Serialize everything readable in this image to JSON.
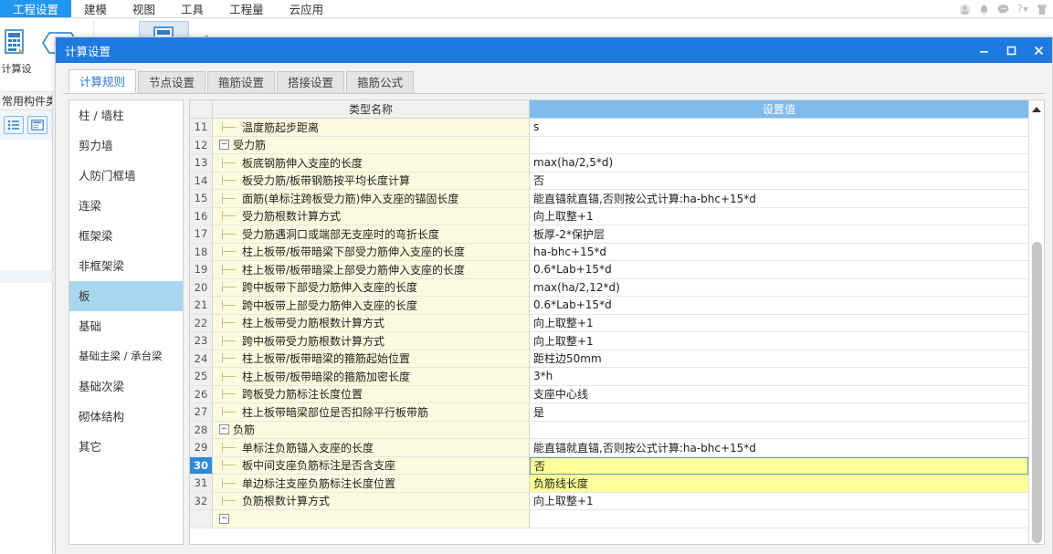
{
  "app": {
    "menu": [
      {
        "label": "工程设置",
        "active": true
      },
      {
        "label": "建模",
        "active": false
      },
      {
        "label": "视图",
        "active": false
      },
      {
        "label": "工具",
        "active": false
      },
      {
        "label": "工程量",
        "active": false
      },
      {
        "label": "云应用",
        "active": false
      }
    ],
    "sys_icons": [
      "account-icon",
      "bell-icon",
      "chat-icon",
      "help-icon",
      "shirt-icon"
    ],
    "ribbon": [
      {
        "icon": "calc-settings-icon",
        "label": "计算设",
        "selected": false
      },
      {
        "icon": "plus-minus-icon",
        "label": "",
        "selected": false
      },
      {
        "icon": "calc-rule-icon",
        "label": "",
        "selected": true
      },
      {
        "icon": "rebar-edit-1-icon",
        "label": "",
        "selected": false
      },
      {
        "icon": "rebar-edit-2-icon",
        "label": "",
        "selected": false
      },
      {
        "icon": "rebar-edit-3-icon",
        "label": "",
        "selected": false
      }
    ],
    "left_panel": {
      "title": "常用构件类",
      "icons": [
        "list-view-icon",
        "card-view-icon"
      ]
    }
  },
  "dialog": {
    "title": "计算设置",
    "window_buttons": {
      "minimize": "minimize-button",
      "maximize": "maximize-button",
      "close": "close-button"
    },
    "tabs": [
      {
        "label": "计算规则",
        "active": true
      },
      {
        "label": "节点设置",
        "active": false
      },
      {
        "label": "箍筋设置",
        "active": false
      },
      {
        "label": "搭接设置",
        "active": false
      },
      {
        "label": "箍筋公式",
        "active": false
      }
    ],
    "sidebar": [
      {
        "label": "柱 / 墙柱",
        "active": false
      },
      {
        "label": "剪力墙",
        "active": false
      },
      {
        "label": "人防门框墙",
        "active": false
      },
      {
        "label": "连梁",
        "active": false
      },
      {
        "label": "框架梁",
        "active": false
      },
      {
        "label": "非框架梁",
        "active": false
      },
      {
        "label": "板",
        "active": true
      },
      {
        "label": "基础",
        "active": false
      },
      {
        "label": "基础主梁 / 承台梁",
        "active": false
      },
      {
        "label": "基础次梁",
        "active": false
      },
      {
        "label": "砌体结构",
        "active": false
      },
      {
        "label": "其它",
        "active": false
      }
    ],
    "grid": {
      "headers": {
        "num": "",
        "name": "类型名称",
        "value": "设置值"
      },
      "rows": [
        {
          "num": "11",
          "kind": "leaf",
          "name": "温度筋起步距离",
          "value": "s",
          "selected": false,
          "value_state": "normal"
        },
        {
          "num": "12",
          "kind": "group",
          "name": "受力筋",
          "value": "",
          "selected": false,
          "value_state": "normal"
        },
        {
          "num": "13",
          "kind": "leaf",
          "name": "板底钢筋伸入支座的长度",
          "value": "max(ha/2,5*d)",
          "selected": false,
          "value_state": "normal"
        },
        {
          "num": "14",
          "kind": "leaf",
          "name": "板受力筋/板带钢筋按平均长度计算",
          "value": "否",
          "selected": false,
          "value_state": "normal"
        },
        {
          "num": "15",
          "kind": "leaf",
          "name": "面筋(单标注跨板受力筋)伸入支座的锚固长度",
          "value": "能直锚就直锚,否则按公式计算:ha-bhc+15*d",
          "selected": false,
          "value_state": "normal"
        },
        {
          "num": "16",
          "kind": "leaf",
          "name": "受力筋根数计算方式",
          "value": "向上取整+1",
          "selected": false,
          "value_state": "normal"
        },
        {
          "num": "17",
          "kind": "leaf",
          "name": "受力筋遇洞口或端部无支座时的弯折长度",
          "value": "板厚-2*保护层",
          "selected": false,
          "value_state": "normal"
        },
        {
          "num": "18",
          "kind": "leaf",
          "name": "柱上板带/板带暗梁下部受力筋伸入支座的长度",
          "value": "ha-bhc+15*d",
          "selected": false,
          "value_state": "normal"
        },
        {
          "num": "19",
          "kind": "leaf",
          "name": "柱上板带/板带暗梁上部受力筋伸入支座的长度",
          "value": "0.6*Lab+15*d",
          "selected": false,
          "value_state": "normal"
        },
        {
          "num": "20",
          "kind": "leaf",
          "name": "跨中板带下部受力筋伸入支座的长度",
          "value": "max(ha/2,12*d)",
          "selected": false,
          "value_state": "normal"
        },
        {
          "num": "21",
          "kind": "leaf",
          "name": "跨中板带上部受力筋伸入支座的长度",
          "value": "0.6*Lab+15*d",
          "selected": false,
          "value_state": "normal"
        },
        {
          "num": "22",
          "kind": "leaf",
          "name": "柱上板带受力筋根数计算方式",
          "value": "向上取整+1",
          "selected": false,
          "value_state": "normal"
        },
        {
          "num": "23",
          "kind": "leaf",
          "name": "跨中板带受力筋根数计算方式",
          "value": "向上取整+1",
          "selected": false,
          "value_state": "normal"
        },
        {
          "num": "24",
          "kind": "leaf",
          "name": "柱上板带/板带暗梁的箍筋起始位置",
          "value": "距柱边50mm",
          "selected": false,
          "value_state": "normal"
        },
        {
          "num": "25",
          "kind": "leaf",
          "name": "柱上板带/板带暗梁的箍筋加密长度",
          "value": "3*h",
          "selected": false,
          "value_state": "normal"
        },
        {
          "num": "26",
          "kind": "leaf",
          "name": "跨板受力筋标注长度位置",
          "value": "支座中心线",
          "selected": false,
          "value_state": "normal"
        },
        {
          "num": "27",
          "kind": "leaf-last",
          "name": "柱上板带暗梁部位是否扣除平行板带筋",
          "value": "是",
          "selected": false,
          "value_state": "normal"
        },
        {
          "num": "28",
          "kind": "group",
          "name": "负筋",
          "value": "",
          "selected": false,
          "value_state": "normal"
        },
        {
          "num": "29",
          "kind": "leaf",
          "name": "单标注负筋锚入支座的长度",
          "value": "能直锚就直锚,否则按公式计算:ha-bhc+15*d",
          "selected": false,
          "value_state": "normal"
        },
        {
          "num": "30",
          "kind": "leaf",
          "name": "板中间支座负筋标注是否含支座",
          "value": "否",
          "selected": true,
          "value_state": "editing"
        },
        {
          "num": "31",
          "kind": "leaf",
          "name": "单边标注支座负筋标注长度位置",
          "value": "负筋线长度",
          "selected": false,
          "value_state": "highlight"
        },
        {
          "num": "32",
          "kind": "leaf-last",
          "name": "负筋根数计算方式",
          "value": "向上取整+1",
          "selected": false,
          "value_state": "normal"
        }
      ]
    },
    "scrollbar": {
      "up_arrow": "scroll-up-arrow"
    }
  },
  "colors": {
    "accent_blue": "#1e7ae0",
    "header_value_blue": "#7fbcee",
    "row_name_yellow": "#fbfbdf",
    "highlight_yellow": "#ffff99",
    "selected_row_num": "#2e8ada",
    "sidebar_active": "#a8d8f0",
    "edit_border": "#5c9ead"
  }
}
